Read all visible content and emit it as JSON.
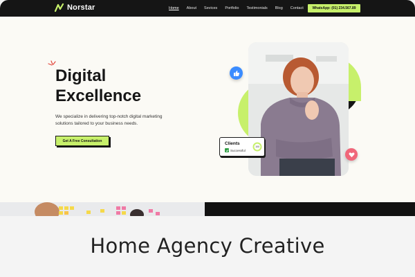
{
  "nav": {
    "brand": "Norstar",
    "items": [
      "Home",
      "About",
      "Sevices",
      "Portfolio",
      "Testimonials",
      "Blog",
      "Contact"
    ],
    "active_index": 0,
    "whatsapp_label": "WhatsApp: (01) 234.567.89"
  },
  "hero": {
    "title_line1": "Digital",
    "title_line2": "Excellence",
    "subtitle_line1": "We specialize in delivering top-notch digital marketing",
    "subtitle_line2": "solutions tailored to your business needs.",
    "cta_label": "Get A Free Consultation"
  },
  "clients_card": {
    "title": "Clients",
    "status": "Successful",
    "progress_label": "100"
  },
  "icons": {
    "logo": "norstar-logo-icon",
    "like": "thumbs-up-icon",
    "heart": "heart-icon",
    "check": "check-icon"
  },
  "colors": {
    "accent": "#c7f06b",
    "dark": "#151515",
    "like_badge": "#3b8cff",
    "heart_badge": "#f0677a"
  },
  "caption": {
    "text": "Home Agency Creative"
  }
}
